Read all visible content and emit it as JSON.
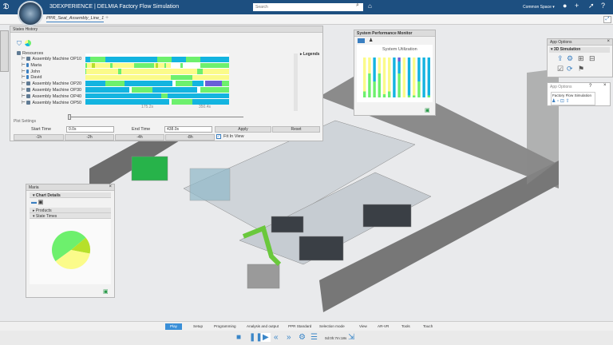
{
  "header": {
    "brand": "3DEXPERIENCE | DELMIA Factory Flow Simulation",
    "search_placeholder": "Search",
    "space": "Common Space ▾"
  },
  "tabs": [
    {
      "label": "PPR_Seat_Assembly_Line_1"
    }
  ],
  "states_history": {
    "title": "States History",
    "legends_label": "Legends",
    "resources_label": "Resources",
    "resources": [
      "Assembly Machine OP10",
      "Maria",
      "John",
      "David",
      "Assembly Machine OP20",
      "Assembly Machine OP30",
      "Assembly Machine OP40",
      "Assembly Machine OP50"
    ],
    "time_range": [
      0,
      438
    ],
    "ticks": [
      "175.2s",
      "350.4s"
    ],
    "colors": {
      "blue": "#13b4e0",
      "green": "#6df06d",
      "yellow": "#fbfb8a",
      "purple": "#6a5fd8",
      "lime": "#b6e02a"
    },
    "timelines": [
      [
        [
          0,
          15,
          "blue"
        ],
        [
          15,
          60,
          "green"
        ],
        [
          60,
          218,
          "blue"
        ],
        [
          218,
          262,
          "green"
        ],
        [
          262,
          307,
          "blue"
        ],
        [
          307,
          350,
          "green"
        ],
        [
          350,
          438,
          "blue"
        ]
      ],
      [
        [
          0,
          4,
          "green"
        ],
        [
          4,
          148,
          "yellow"
        ],
        [
          20,
          28,
          "lime"
        ],
        [
          75,
          82,
          "green"
        ],
        [
          148,
          210,
          "green"
        ],
        [
          210,
          260,
          "yellow"
        ],
        [
          215,
          222,
          "lime"
        ],
        [
          240,
          246,
          "green"
        ],
        [
          290,
          298,
          "green"
        ],
        [
          350,
          438,
          "green"
        ]
      ],
      [
        [
          0,
          438,
          "yellow"
        ],
        [
          0,
          3,
          "green"
        ],
        [
          100,
          110,
          "green"
        ],
        [
          340,
          358,
          "green"
        ]
      ],
      [
        [
          0,
          438,
          "yellow"
        ],
        [
          260,
          325,
          "green"
        ]
      ],
      [
        [
          0,
          60,
          "blue"
        ],
        [
          60,
          120,
          "green"
        ],
        [
          120,
          265,
          "blue"
        ],
        [
          275,
          325,
          "green"
        ],
        [
          325,
          360,
          "blue"
        ],
        [
          365,
          415,
          "purple"
        ],
        [
          415,
          438,
          "green"
        ]
      ],
      [
        [
          0,
          135,
          "blue"
        ],
        [
          140,
          205,
          "green"
        ],
        [
          205,
          340,
          "blue"
        ],
        [
          350,
          438,
          "green"
        ]
      ],
      [
        [
          0,
          230,
          "blue"
        ],
        [
          230,
          250,
          "green"
        ],
        [
          250,
          438,
          "blue"
        ]
      ],
      [
        [
          0,
          255,
          "blue"
        ],
        [
          262,
          325,
          "green"
        ],
        [
          325,
          438,
          "blue"
        ]
      ]
    ],
    "plot_settings": {
      "title": "Plot Settings",
      "start_label": "Start Time",
      "start_value": "0.0s",
      "end_label": "End Time",
      "end_value": "438.0s",
      "apply": "Apply",
      "reset": "Reset",
      "steps": [
        "-1h",
        "-2h",
        "-4h",
        "-8h"
      ],
      "fit_label": "Fit In View",
      "fit_checked": true
    }
  },
  "system_monitor": {
    "title": "System Performance Monitor",
    "chart_title": "System Utilization",
    "bars": [
      {
        "green": 15,
        "yellow": 85,
        "blue": 0,
        "purple": 0
      },
      {
        "green": 60,
        "yellow": 40,
        "blue": 0,
        "purple": 0
      },
      {
        "green": 40,
        "yellow": 0,
        "blue": 60,
        "purple": 0
      },
      {
        "green": 60,
        "yellow": 40,
        "blue": 0,
        "purple": 0
      },
      {
        "green": 8,
        "yellow": 92,
        "blue": 0,
        "purple": 0
      },
      {
        "green": 15,
        "yellow": 85,
        "blue": 0,
        "purple": 0
      },
      {
        "green": 0,
        "yellow": 0,
        "blue": 100,
        "purple": 0
      },
      {
        "green": 60,
        "yellow": 0,
        "blue": 30,
        "purple": 10
      },
      {
        "green": 0,
        "yellow": 100,
        "blue": 0,
        "purple": 0
      },
      {
        "green": 5,
        "yellow": 0,
        "blue": 95,
        "purple": 0
      },
      {
        "green": 5,
        "yellow": 95,
        "blue": 0,
        "purple": 0
      },
      {
        "green": 40,
        "yellow": 0,
        "blue": 60,
        "purple": 0
      },
      {
        "green": 0,
        "yellow": 0,
        "blue": 100,
        "purple": 0
      },
      {
        "green": 5,
        "yellow": 0,
        "blue": 95,
        "purple": 0
      }
    ]
  },
  "app_options": {
    "title": "App Options",
    "section": "3D Simulation"
  },
  "app_options2": {
    "title": "App Options",
    "help": "?",
    "section": "Factory Flow Simulation"
  },
  "maria_panel": {
    "title": "Maria",
    "chart_details": "Chart Details",
    "products": "Products",
    "state_times": "State Times",
    "pie": [
      {
        "value": 49,
        "color": "#6df06d"
      },
      {
        "value": 14,
        "color": "#b6e02a"
      },
      {
        "value": 37,
        "color": "#fbfb8a"
      }
    ]
  },
  "bottom_tabs": [
    "Play",
    "Setup",
    "Programming",
    "Analysis and output",
    "PPR Standard",
    "Selection mode",
    "View",
    "AR-VR",
    "Tools",
    "Touch"
  ],
  "playback": {
    "time": "0d:0h:7m:18s"
  }
}
